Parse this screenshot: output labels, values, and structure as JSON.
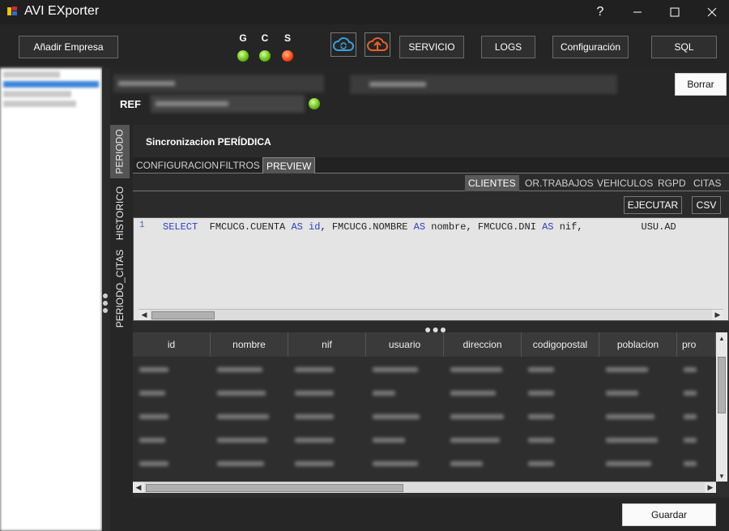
{
  "window": {
    "title": "AVI EXporter",
    "help": "?",
    "minimize": "—",
    "maximize": "☐",
    "close": "✕"
  },
  "toolbar": {
    "add_company": "Añadir Empresa",
    "indicators": [
      {
        "label": "G",
        "status": "green"
      },
      {
        "label": "C",
        "status": "green"
      },
      {
        "label": "S",
        "status": "red"
      }
    ],
    "servicio": "SERVICIO",
    "logs": "LOGS",
    "configuracion": "Configuración",
    "sql": "SQL"
  },
  "header": {
    "ref_label": "REF",
    "borrar": "Borrar"
  },
  "vertical_tabs": [
    "PERIODO",
    "HISTORICO",
    "PERIODO_CITAS"
  ],
  "section": {
    "title": "Sincronizacion PERÍDDICA"
  },
  "tabs": [
    {
      "label": "CONFIGURACION",
      "active": false
    },
    {
      "label": "FILTROS",
      "active": false
    },
    {
      "label": "PREVIEW",
      "active": true
    }
  ],
  "subtabs": [
    {
      "label": "CLIENTES",
      "active": true
    },
    {
      "label": "OR.TRABAJOS",
      "active": false
    },
    {
      "label": "VEHICULOS",
      "active": false
    },
    {
      "label": "RGPD",
      "active": false
    },
    {
      "label": "CITAS",
      "active": false
    }
  ],
  "actions": {
    "ejecutar": "EJECUTAR",
    "csv": "CSV"
  },
  "editor": {
    "line_number": "1",
    "tokens": [
      {
        "t": "SELECT",
        "kw": true
      },
      {
        "t": "  FMCUCG.CUENTA ",
        "kw": false
      },
      {
        "t": "AS",
        "kw": true
      },
      {
        "t": " ",
        "kw": false
      },
      {
        "t": "id",
        "kw": true
      },
      {
        "t": ", FMCUCG.NOMBRE ",
        "kw": false
      },
      {
        "t": "AS",
        "kw": true
      },
      {
        "t": " nombre, FMCUCG.DNI ",
        "kw": false
      },
      {
        "t": "AS",
        "kw": true
      },
      {
        "t": " nif,          USU.AD",
        "kw": false
      }
    ]
  },
  "grid": {
    "columns": [
      "id",
      "nombre",
      "nif",
      "usuario",
      "direccion",
      "codigopostal",
      "poblacion",
      "pro"
    ],
    "row_count": 7
  },
  "footer": {
    "guardar": "Guardar"
  },
  "colors": {
    "background": "#2b2b2b",
    "led_green": "#6cc21a",
    "led_red": "#ff4b10",
    "cloud_blue": "#3aa0e0",
    "cloud_orange": "#e8622a",
    "selection_blue": "#3d86d8"
  }
}
